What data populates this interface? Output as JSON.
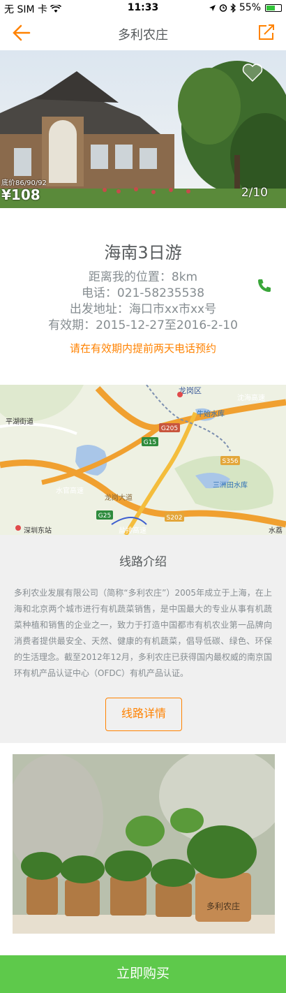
{
  "status_bar": {
    "carrier": "无 SIM 卡",
    "time": "11:33",
    "battery": "55%",
    "battery_level": 0.55
  },
  "nav": {
    "title": "多利农庄"
  },
  "hero": {
    "old_price": "底价86/90/92",
    "price": "¥108",
    "counter": "2/10"
  },
  "info": {
    "title": "海南3日游",
    "distance": "距离我的位置：8km",
    "phone": "电话：021-58235538",
    "address": "出发地址：海口市xx市xx号",
    "validity": "有效期：2015-12-27至2016-2-10",
    "booking_note": "请在有效期内提前两天电话预约"
  },
  "map": {
    "labels": {
      "district": "龙岗区",
      "reservoir1": "牛始水库",
      "reservoir2": "三洲田水库",
      "street": "平湖街道",
      "station": "深圳东站",
      "road1": "水官高速",
      "road2": "龙岗大道",
      "road3": "盐排高速",
      "road4": "沈海高速",
      "road5": "水荔",
      "g205": "G205",
      "g15": "G15",
      "g25": "G25",
      "s202": "S202",
      "s356": "S356"
    }
  },
  "route": {
    "title": "线路介绍",
    "text": "多利农业发展有限公司（简称“多利农庄”）2005年成立于上海，在上海和北京两个城市进行有机蔬菜销售，是中国最大的专业从事有机蔬菜种植和销售的企业之一，致力于打造中国都市有机农业第一品牌向消费者提供最安全、天然、健康的有机蔬菜，倡导低碳、绿色、环保的生活理念。截至2012年12月，多利农庄已获得国内最权威的南京国环有机产品认证中心（OFDC）有机产品认证。",
    "detail_button": "线路详情"
  },
  "plants_image": {
    "pot_label": "多利农庄"
  },
  "footer": {
    "buy_button": "立即购买"
  },
  "colors": {
    "accent": "#ff8200",
    "text_dark": "#565a5c",
    "text_light": "#868d91",
    "bg_gray": "#f0f0f0",
    "buy_green": "#5ec94b"
  },
  "icons": [
    "back-arrow-icon",
    "share-icon",
    "heart-icon",
    "phone-icon",
    "wifi-icon",
    "location-icon",
    "alarm-icon",
    "bluetooth-icon",
    "battery-icon"
  ]
}
